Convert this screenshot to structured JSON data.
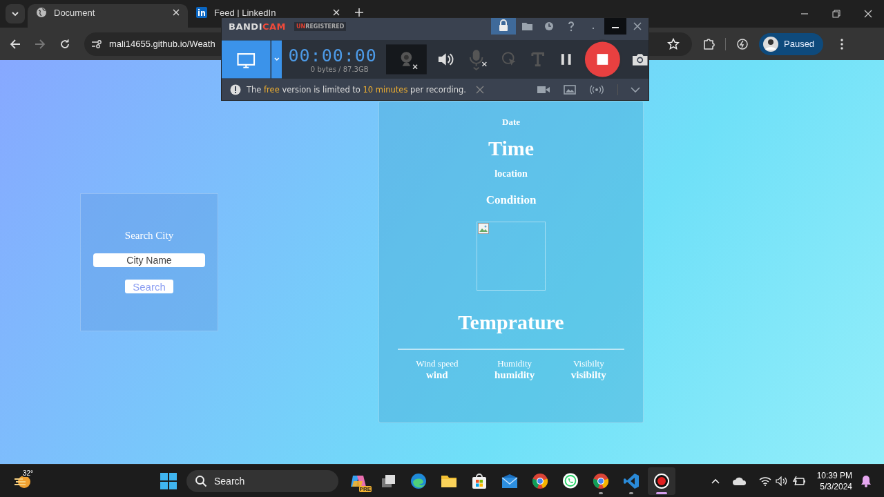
{
  "browser": {
    "tabs": [
      {
        "title": "Document",
        "selected": true
      },
      {
        "title": "Feed | LinkedIn",
        "selected": false
      }
    ],
    "address": "mali14655.github.io/Weath",
    "profile": "Paused"
  },
  "page": {
    "search_card": {
      "title": "Search City",
      "placeholder": "City Name",
      "button": "Search"
    },
    "weather_card": {
      "date": "Date",
      "time": "Time",
      "location": "location",
      "condition": "Condition",
      "temperature": "Temprature",
      "stats": [
        {
          "label": "Wind speed",
          "value": "wind"
        },
        {
          "label": "Humidity",
          "value": "humidity"
        },
        {
          "label": "Visibilty",
          "value": "visibilty"
        }
      ]
    }
  },
  "recorder": {
    "logo": [
      {
        "text": "BANDI",
        "accent": false
      },
      {
        "text": "CAM",
        "accent": true
      }
    ],
    "badge": [
      {
        "text": "UN",
        "accent": true
      },
      {
        "text": "REGISTERED",
        "accent": false
      }
    ],
    "timer": "00:00:00",
    "size": "0 bytes / 87.3GB",
    "notice": [
      {
        "text": "The ",
        "accent": false
      },
      {
        "text": "free",
        "accent": true
      },
      {
        "text": " version is limited to ",
        "accent": false
      },
      {
        "text": "10 minutes",
        "accent": true
      },
      {
        "text": " per recording.",
        "accent": false
      }
    ]
  },
  "taskbar": {
    "weather": "32°",
    "search": "Search",
    "time": "10:39 PM",
    "date": "5/3/2024",
    "apps": [
      {
        "kind": "copilot",
        "badge": "PRE",
        "running": false,
        "selected": false
      },
      {
        "kind": "taskview",
        "running": false,
        "selected": false
      },
      {
        "kind": "edge",
        "running": false,
        "selected": false
      },
      {
        "kind": "explorer",
        "running": false,
        "selected": false
      },
      {
        "kind": "store",
        "running": false,
        "selected": false
      },
      {
        "kind": "mail",
        "running": false,
        "selected": false
      },
      {
        "kind": "chrome",
        "running": false,
        "selected": false
      },
      {
        "kind": "whatsapp",
        "running": false,
        "selected": false
      },
      {
        "kind": "chrome",
        "running": true,
        "selected": false
      },
      {
        "kind": "vscode",
        "running": true,
        "selected": false
      },
      {
        "kind": "recorder",
        "running": true,
        "selected": true
      }
    ]
  }
}
